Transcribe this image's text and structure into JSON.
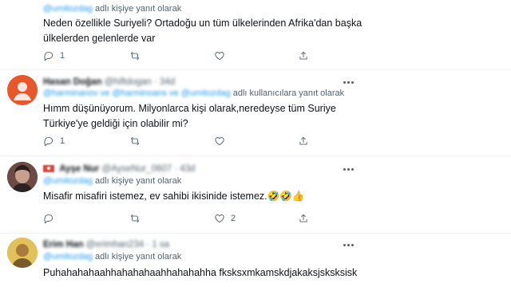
{
  "replies": [
    {
      "reply_to_handle": "@umitozdag",
      "reply_to_suffix": "adlı kişiye yanıt olarak",
      "text_lines": [
        "Neden özellikle Suriyeli?  Ortadoğu un tüm ülkelerinden Afrika'dan başka",
        "ülkelerden gelenlerde var"
      ],
      "reply_count": "1",
      "retweet_count": "",
      "like_count": ""
    },
    {
      "author_name": "Hasan Doğan",
      "author_handle": "@hiftdogan · 34d",
      "reply_to_handle": "@harminanov ve @harminoans ve @umitozdag",
      "reply_to_suffix": "adlı kullanıcılara yanıt olarak",
      "text_lines": [
        "Hımm düşünüyorum. Milyonlarca kişi olarak,neredeyse tüm Suriye",
        "Türkiye'ye geldiği için olabilir mi?"
      ],
      "reply_count": "1",
      "retweet_count": "",
      "like_count": ""
    },
    {
      "author_name": "Ayşe Nur",
      "author_handle": "@AyseNur_0607 · 43d",
      "reply_to_handle": "@umitozdag",
      "reply_to_suffix": "adlı kişiye yanıt olarak",
      "text_lines": [
        "Misafir misafiri istemez, ev sahibi ikisinide istemez.🤣🤣👍"
      ],
      "reply_count": "",
      "retweet_count": "",
      "like_count": "2"
    },
    {
      "author_name": "Erim Han",
      "author_handle": "@erimhan234 · 1 sa",
      "reply_to_handle": "@umitozdag",
      "reply_to_suffix": "adlı kişiye yanıt olarak",
      "text_lines": [
        "Puhahahahaahhahahahaahhahahahha fksksxmkamskdjakaksjsksksisk"
      ]
    }
  ],
  "icons": {
    "reply": "reply-icon",
    "retweet": "retweet-icon",
    "like": "like-icon",
    "share": "share-icon",
    "more": "more-icon"
  },
  "colors": {
    "accent": "#1d9bf0",
    "secondary_text": "#536471",
    "divider": "#eff3f4",
    "avatar_2": "#e8572a"
  }
}
